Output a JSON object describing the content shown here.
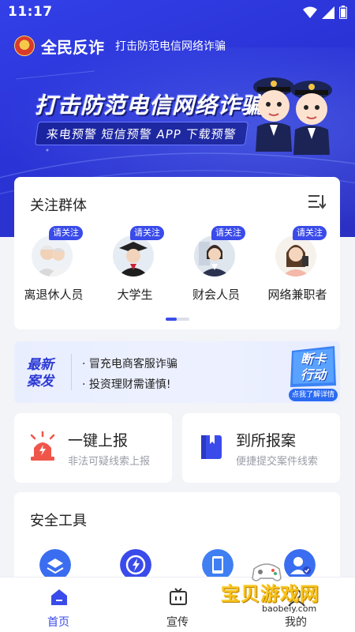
{
  "status_bar": {
    "time": "11:17"
  },
  "header": {
    "app_name": "全民反诈",
    "slogan": "打击防范电信网络诈骗"
  },
  "banner": {
    "title": "打击防范电信网络诈骗",
    "subtitle": "来电预警  短信预警  APP 下载预警"
  },
  "groups": {
    "title": "关注群体",
    "follow_label": "请关注",
    "items": [
      {
        "label": "离退休人员"
      },
      {
        "label": "大学生"
      },
      {
        "label": "财会人员"
      },
      {
        "label": "网络兼职者"
      }
    ]
  },
  "news": {
    "tag": "最新案发",
    "items": [
      "冒充电商客服诈骗",
      "投资理财需谨慎!"
    ],
    "promo_title_1": "断卡",
    "promo_title_2": "行动",
    "promo_button": "点我了解详情"
  },
  "actions": [
    {
      "title": "一键上报",
      "subtitle": "非法可疑线索上报"
    },
    {
      "title": "到所报案",
      "subtitle": "便捷提交案件线索"
    }
  ],
  "tools": {
    "title": "安全工具"
  },
  "tabbar": {
    "items": [
      {
        "label": "首页",
        "active": true
      },
      {
        "label": "宣传",
        "active": false
      },
      {
        "label": "",
        "active": false
      },
      {
        "label": "我的",
        "active": false
      }
    ]
  },
  "watermark": {
    "text": "宝贝游戏网",
    "url": "baobeiy.com"
  },
  "colors": {
    "brand": "#3a4bea",
    "hero": "#2c36d8",
    "alert": "#f0554a"
  }
}
